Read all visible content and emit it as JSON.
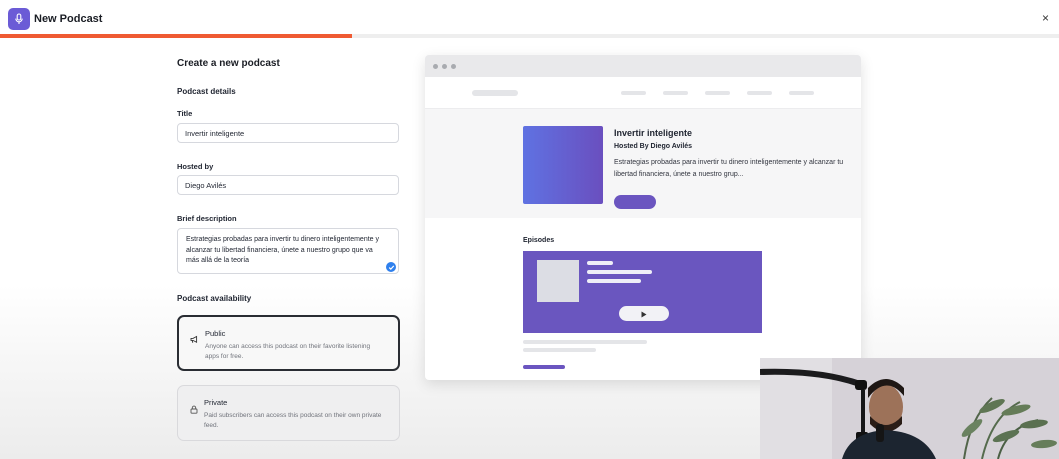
{
  "app": {
    "title": "New Podcast",
    "close_glyph": "×",
    "progress_fraction": 0.332,
    "accent_color": "#6b5bd6",
    "progress_color": "#ef5a32",
    "icon": "microphone-icon"
  },
  "form": {
    "heading": "Create a new podcast",
    "section_details": "Podcast details",
    "title_label": "Title",
    "title_value": "Invertir inteligente",
    "hosted_label": "Hosted by",
    "hosted_value": "Diego Avilés",
    "description_label": "Brief description",
    "description_value": "Estrategias probadas para invertir tu dinero inteligentemente y alcanzar tu libertad financiera, únete a nuestro grupo que va más allá de la teoría",
    "section_availability": "Podcast availability",
    "options": [
      {
        "title": "Public",
        "description": "Anyone can access this podcast on their favorite listening apps for free.",
        "selected": true,
        "icon": "megaphone-icon"
      },
      {
        "title": "Private",
        "description": "Paid subscribers can access this podcast on their own private feed.",
        "selected": false,
        "icon": "lock-icon"
      }
    ]
  },
  "preview": {
    "podcast_title": "Invertir inteligente",
    "hosted_line": "Hosted By Diego Avilés",
    "description": "Estrategias probadas para invertir tu dinero inteligentemente y alcanzar tu libertad financiera, únete a nuestro grup...",
    "episodes_label": "Episodes",
    "brand_color": "#6a56bf"
  }
}
